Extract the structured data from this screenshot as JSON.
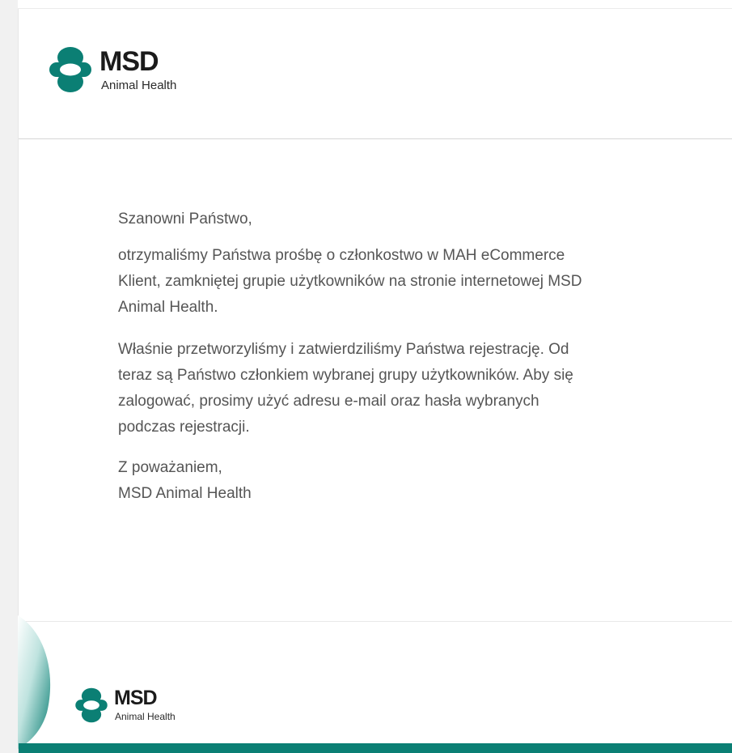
{
  "header": {
    "logo": {
      "icon": "msd-logo-mark-icon",
      "wordmark": "MSD",
      "subtitle": "Animal Health"
    }
  },
  "message": {
    "greeting": "Szanowni Państwo,",
    "paragraph1": [
      "otrzymaliśmy Państwa prośbę o członkostwo w MAH eCommerce",
      "Klient, zamkniętej grupie użytkowników na stronie internetowej MSD",
      "Animal Health."
    ],
    "paragraph2": [
      "Właśnie przetworzyliśmy i zatwierdziliśmy Państwa rejestrację. Od",
      "teraz są Państwo członkiem wybranej grupy użytkowników. Aby się",
      "zalogować, prosimy użyć adresu e-mail oraz hasła wybranych",
      "podczas rejestracji."
    ],
    "closing": "Z poważaniem,",
    "signature": "MSD Animal Health"
  },
  "footer": {
    "logo": {
      "icon": "msd-logo-mark-icon",
      "wordmark": "MSD",
      "subtitle": "Animal Health"
    }
  },
  "colors": {
    "brand_teal": "#0b7f74",
    "text_gray": "#555555"
  }
}
